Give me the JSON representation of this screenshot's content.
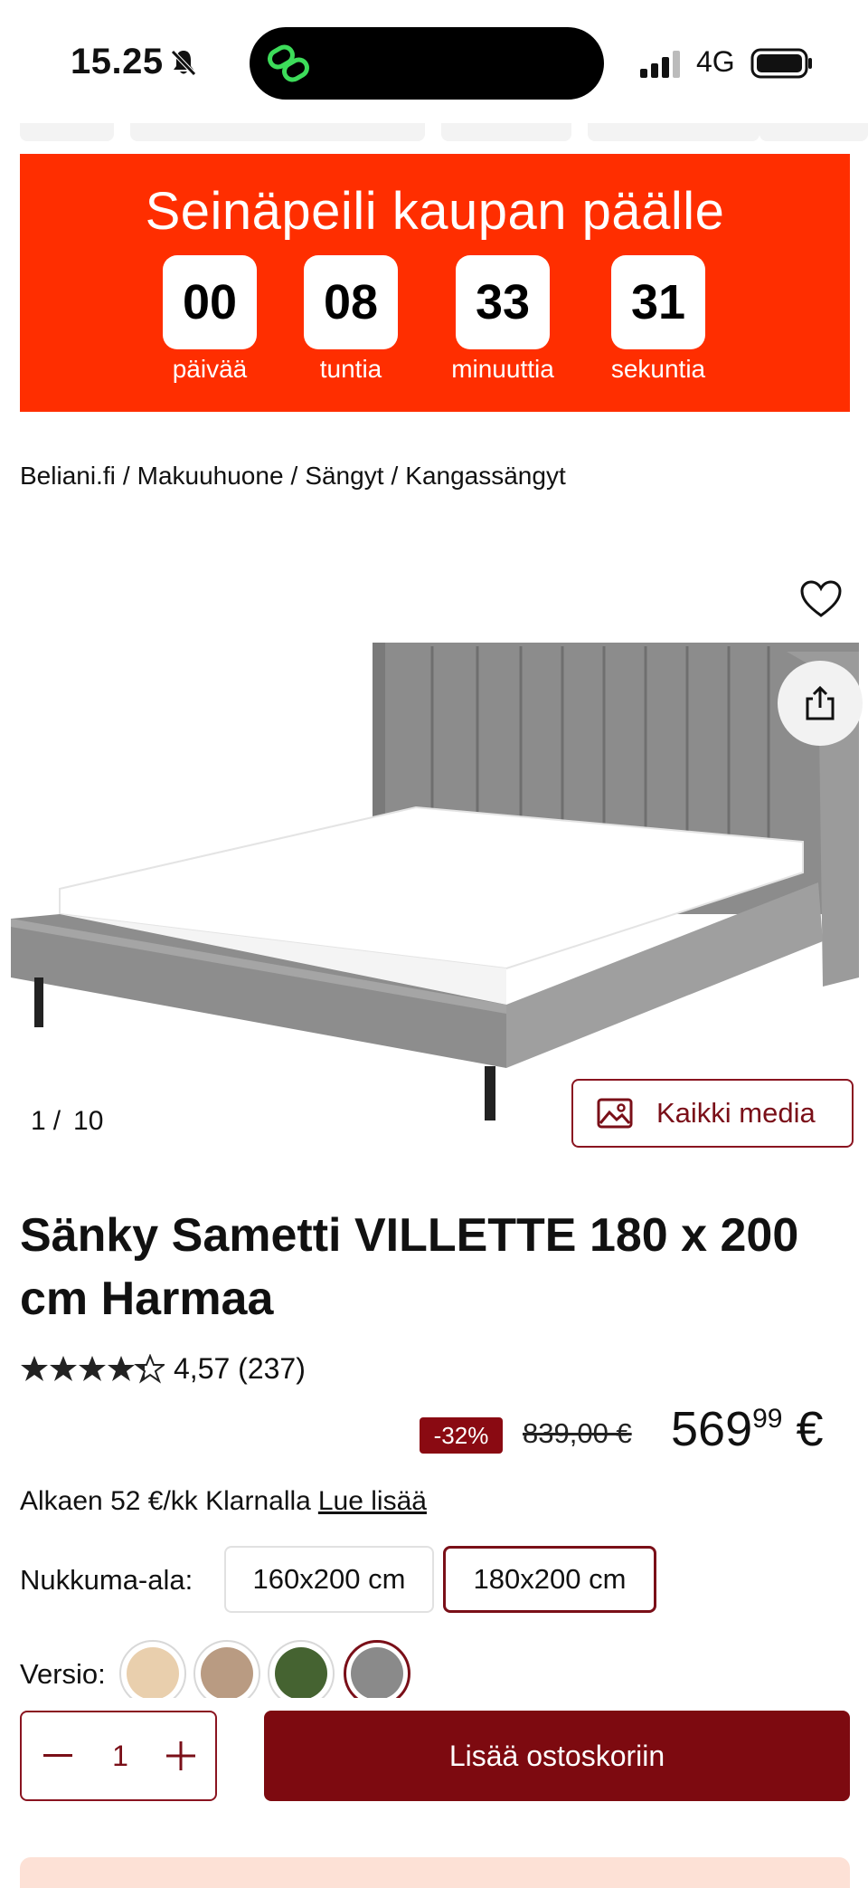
{
  "status_bar": {
    "time": "15.25",
    "network": "4G"
  },
  "promo": {
    "title": "Seinäpeili kaupan päälle",
    "countdown": [
      {
        "value": "00",
        "label": "päivää"
      },
      {
        "value": "08",
        "label": "tuntia"
      },
      {
        "value": "33",
        "label": "minuuttia"
      },
      {
        "value": "31",
        "label": "sekuntia"
      }
    ]
  },
  "breadcrumb": [
    "Beliani.fi",
    "Makuuhuone",
    "Sängyt",
    "Kangassängyt"
  ],
  "breadcrumb_sep": "/",
  "gallery": {
    "current": "1",
    "sep": "/",
    "total": "10",
    "media_button": "Kaikki media"
  },
  "product": {
    "title": "Sänky Sametti VILLETTE 180 x 200 cm Harmaa",
    "rating_text": "4,57 (237)",
    "rating": 4.57,
    "discount": "-32%",
    "old_price": "839,00 €",
    "price_main": "569",
    "price_cents": "99",
    "currency": "€",
    "klarna_text": "Alkaen 52 €/kk Klarnalla",
    "klarna_link": "Lue lisää"
  },
  "size": {
    "label": "Nukkuma-ala:",
    "options": [
      "160x200 cm",
      "180x200 cm"
    ],
    "selected": "180x200 cm"
  },
  "version": {
    "label": "Versio:",
    "swatches": [
      "#e9cfad",
      "#b99b82",
      "#456331",
      "#8a8a8a"
    ],
    "selected_index": 3
  },
  "cart": {
    "quantity": "1",
    "add_label": "Lisää ostoskoriin"
  },
  "colors": {
    "promo_bg": "#ff2e00",
    "brand": "#7d0a10"
  }
}
